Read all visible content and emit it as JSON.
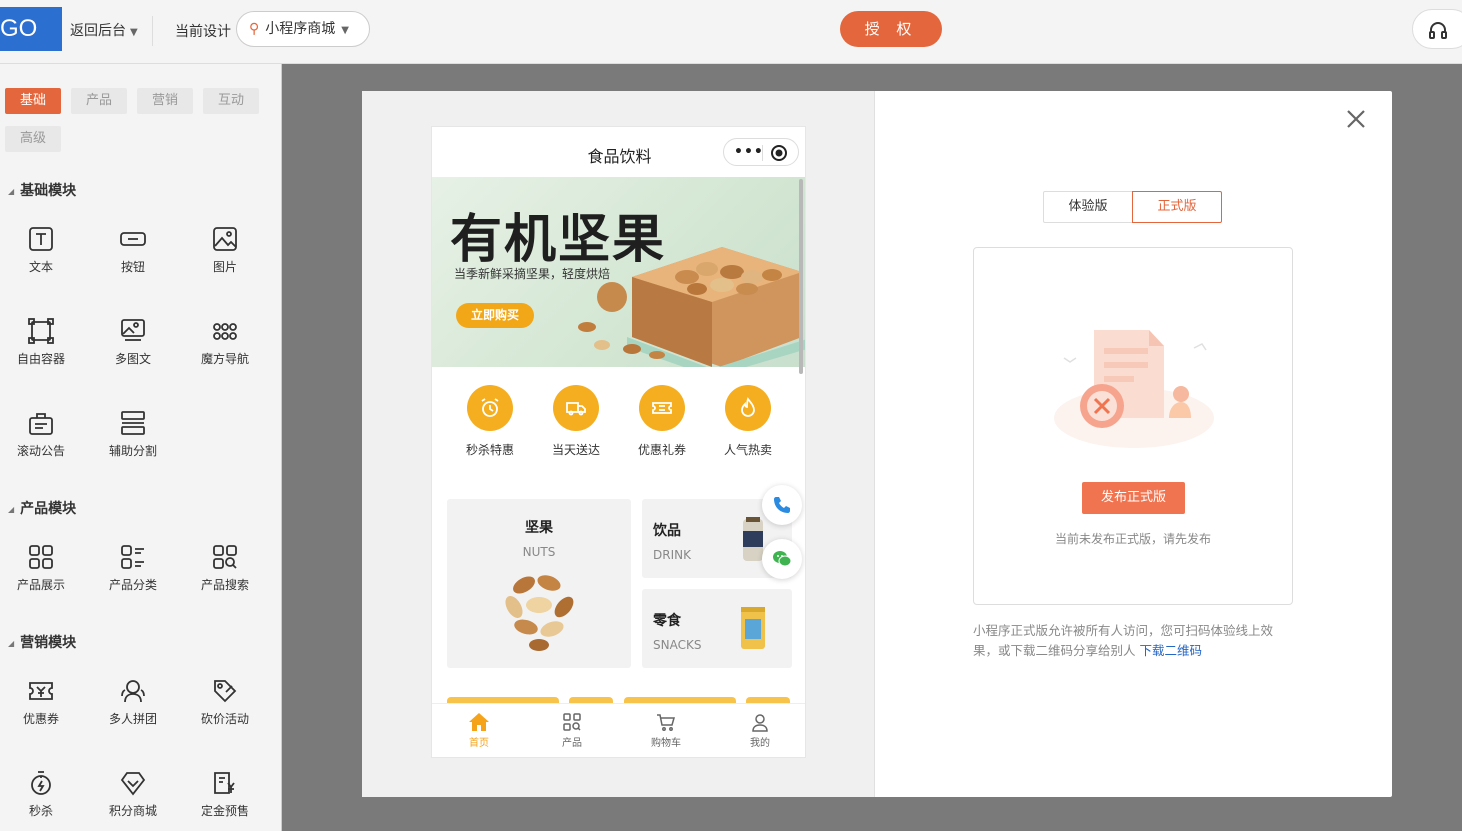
{
  "topbar": {
    "logo_text": "GO",
    "back_label": "返回后台",
    "current_design_label": "当前设计",
    "design_name": "小程序商城",
    "auth_label": "授 权"
  },
  "sidebar": {
    "tabs": [
      "基础",
      "产品",
      "营销",
      "互动",
      "高级"
    ],
    "active_tab": "基础",
    "sections": [
      {
        "title": "基础模块",
        "items": [
          "文本",
          "按钮",
          "图片",
          "自由容器",
          "多图文",
          "魔方导航",
          "滚动公告",
          "辅助分割"
        ]
      },
      {
        "title": "产品模块",
        "items": [
          "产品展示",
          "产品分类",
          "产品搜索"
        ]
      },
      {
        "title": "营销模块",
        "items": [
          "优惠券",
          "多人拼团",
          "砍价活动",
          "秒杀",
          "积分商城",
          "定金预售"
        ]
      }
    ]
  },
  "phone": {
    "title": "食品饮料",
    "banner": {
      "headline": "有机坚果",
      "subtitle": "当季新鲜采摘坚果，轻度烘焙",
      "button": "立即购买"
    },
    "quick_nav": [
      "秒杀特惠",
      "当天送达",
      "优惠礼券",
      "人气热卖"
    ],
    "categories": [
      {
        "title": "坚果",
        "subtitle": "NUTS"
      },
      {
        "title": "饮品",
        "subtitle": "DRINK"
      },
      {
        "title": "零食",
        "subtitle": "SNACKS"
      }
    ],
    "tabbar": [
      "首页",
      "产品",
      "购物车",
      "我的"
    ],
    "active_tab": "首页"
  },
  "publish": {
    "version_tabs": [
      "体验版",
      "正式版"
    ],
    "active_version": "正式版",
    "publish_button": "发布正式版",
    "hint": "当前未发布正式版，请先发布",
    "description": "小程序正式版允许被所有人访问，您可扫码体验线上效果，或下载二维码分享给别人",
    "download_link": "下载二维码"
  },
  "colors": {
    "accent": "#e3663c",
    "phone_accent": "#f5ae1f",
    "link": "#2567c4"
  }
}
